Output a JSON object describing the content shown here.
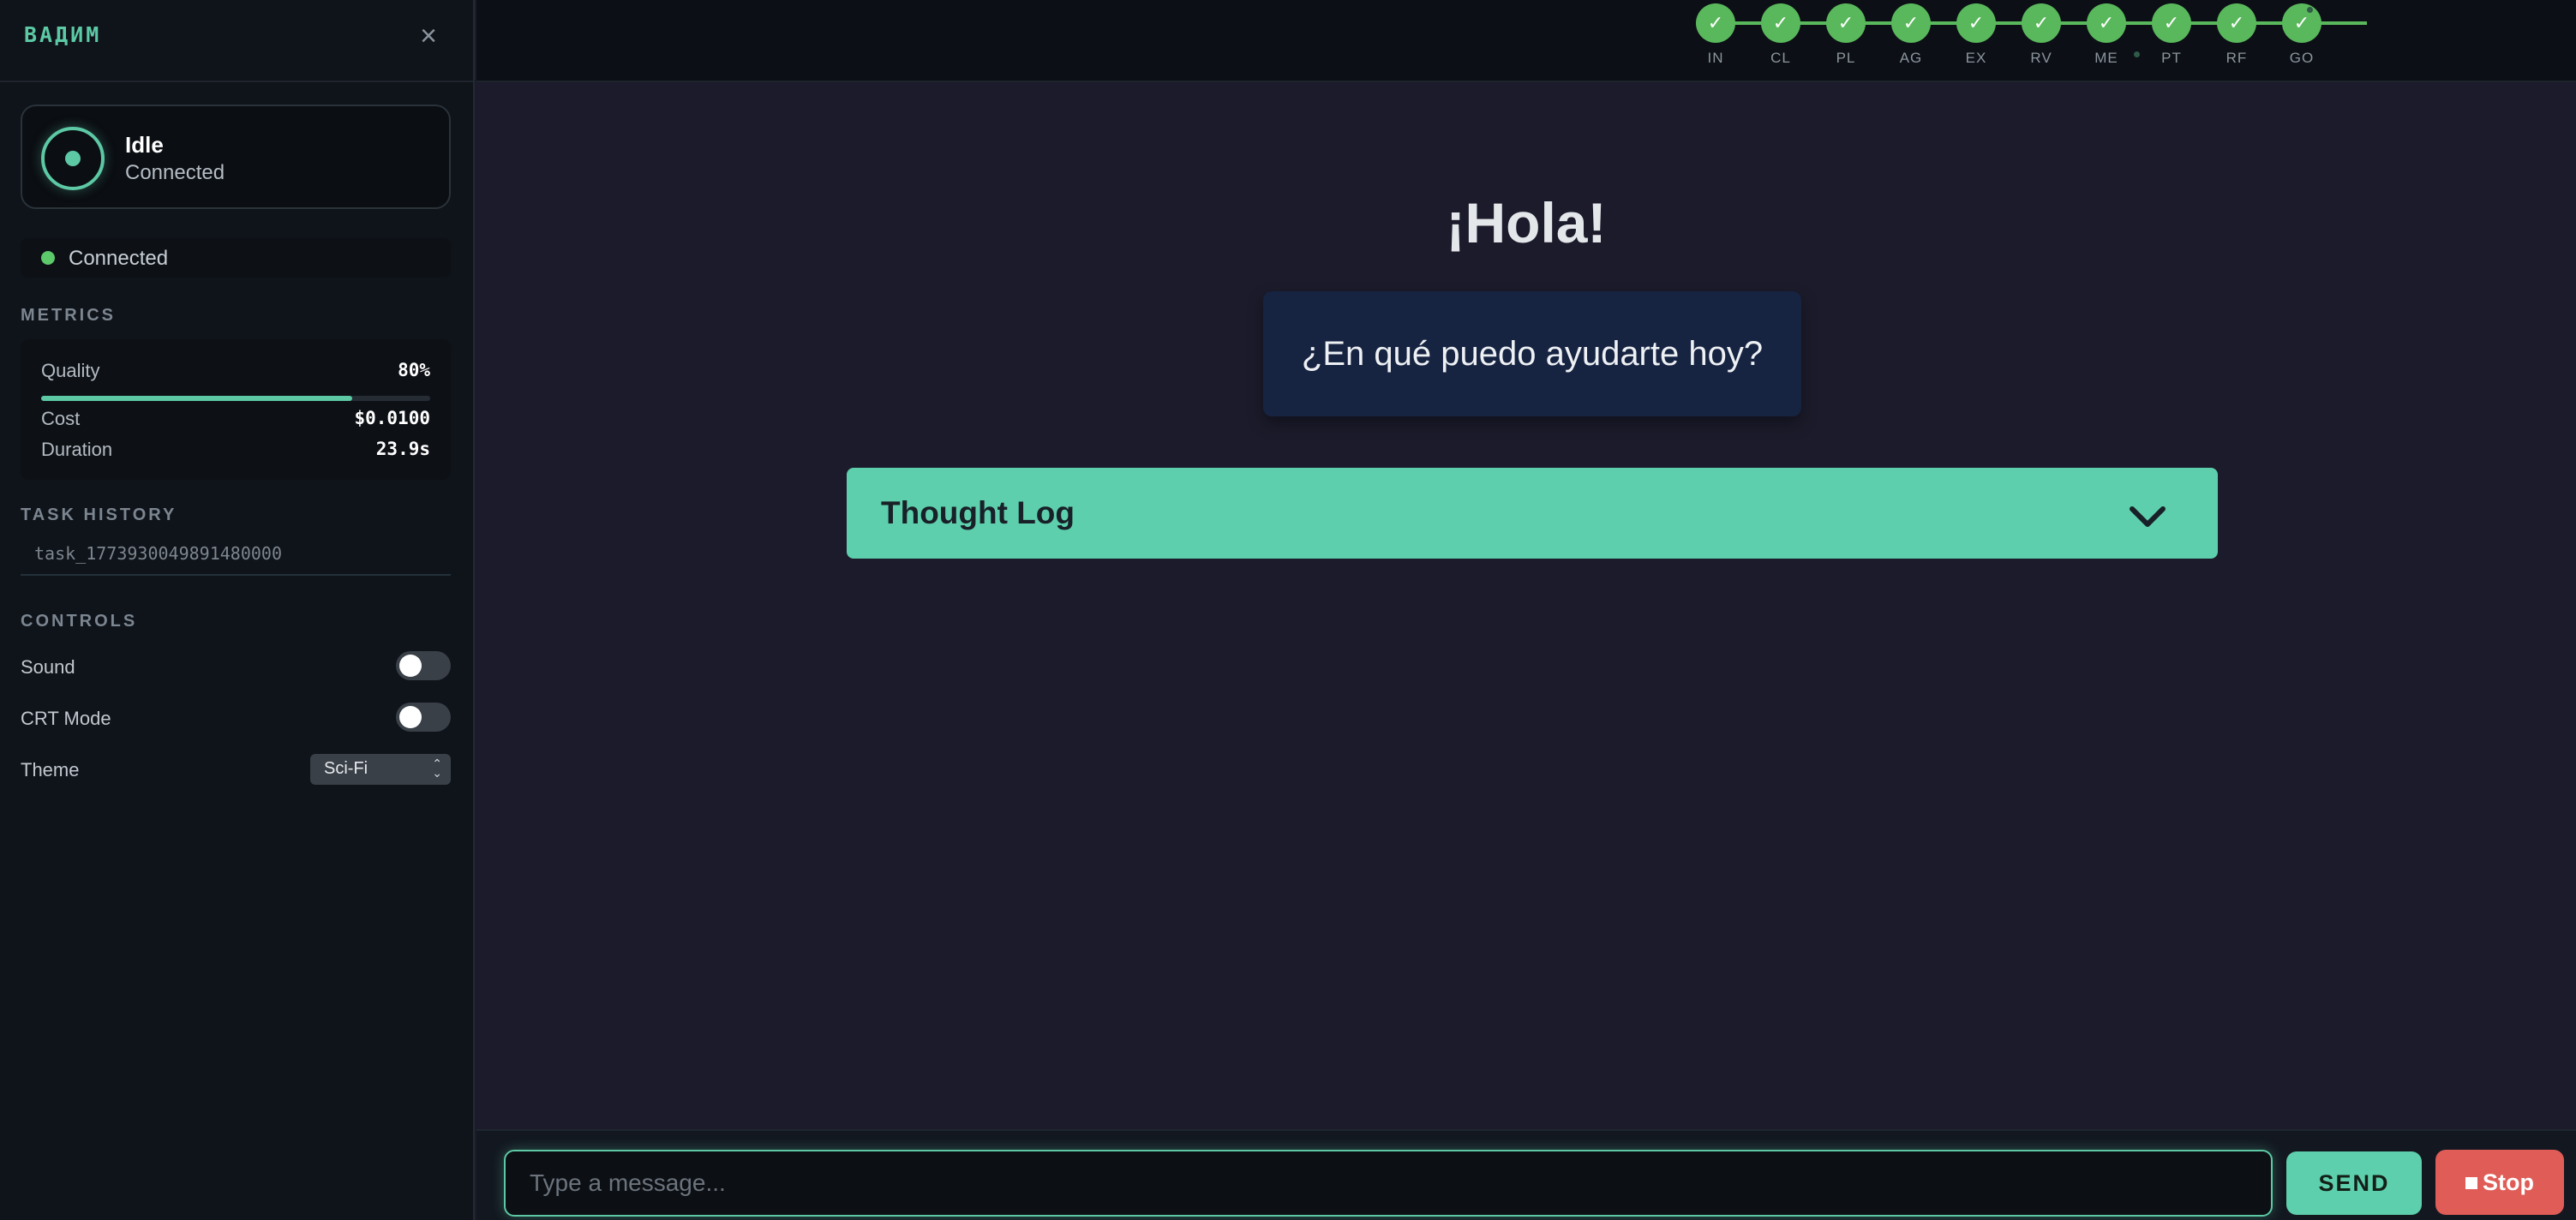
{
  "sidebar": {
    "brand": "ВАДИМ",
    "close_glyph": "×",
    "status": {
      "title": "Idle",
      "subtitle": "Connected",
      "icon": "status-ring-icon"
    },
    "connection": {
      "label": "Connected",
      "color": "#5cc96b"
    },
    "metrics_heading": "METRICS",
    "metrics": {
      "quality": {
        "label": "Quality",
        "value": "80%",
        "fraction": 0.8
      },
      "cost": {
        "label": "Cost",
        "value": "$0.0100"
      },
      "duration": {
        "label": "Duration",
        "value": "23.9s"
      }
    },
    "history_heading": "TASK HISTORY",
    "history": [
      "task_1773930049891480000"
    ],
    "controls_heading": "CONTROLS",
    "controls": {
      "sound": {
        "label": "Sound",
        "on": false
      },
      "crt": {
        "label": "CRT Mode",
        "on": false
      },
      "theme": {
        "label": "Theme",
        "value": "Sci-Fi"
      }
    }
  },
  "pipeline": {
    "steps": [
      {
        "label": "IN",
        "status": "done"
      },
      {
        "label": "CL",
        "status": "done"
      },
      {
        "label": "PL",
        "status": "done"
      },
      {
        "label": "AG",
        "status": "done"
      },
      {
        "label": "EX",
        "status": "done"
      },
      {
        "label": "RV",
        "status": "done"
      },
      {
        "label": "ME",
        "status": "done"
      },
      {
        "label": "PT",
        "status": "done"
      },
      {
        "label": "RF",
        "status": "done"
      },
      {
        "label": "GO",
        "status": "done"
      }
    ],
    "check_glyph": "✓",
    "color": "#5ab85c"
  },
  "main": {
    "greeting": "¡Hola!",
    "subtitle": "¿En qué puedo ayudarte hoy?",
    "thought_log": {
      "title": "Thought Log",
      "icon": "chevron-down-icon"
    }
  },
  "composer": {
    "placeholder": "Type a message...",
    "send_label": "SEND",
    "stop_label": "Stop"
  },
  "colors": {
    "accent": "#5cc9a4",
    "stop": "#e05c57",
    "background": "#1b1b2b",
    "sidebar": "#0f131a"
  }
}
